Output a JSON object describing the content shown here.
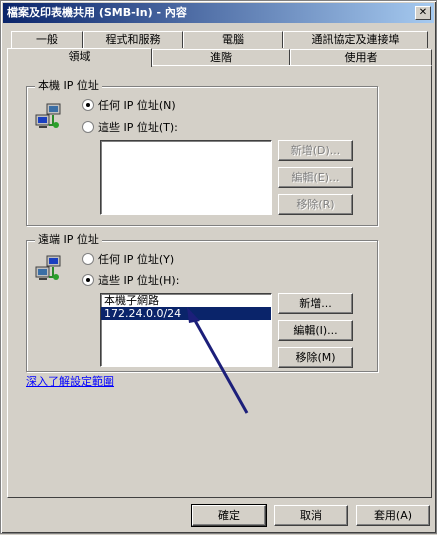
{
  "window": {
    "title": "檔案及印表機共用 (SMB-In) - 內容",
    "close": "✕"
  },
  "tabs": {
    "row1": [
      "一般",
      "程式和服務",
      "電腦",
      "通訊協定及連接埠"
    ],
    "row2": [
      "領域",
      "進階",
      "使用者"
    ]
  },
  "local": {
    "title": "本機 IP 位址",
    "any_ip": "任何 IP 位址(N)",
    "these_ip": "這些 IP 位址(T):",
    "selected": "any",
    "buttons": {
      "add": "新增(D)...",
      "edit": "編輯(E)...",
      "remove": "移除(R)"
    }
  },
  "remote": {
    "title": "遠端 IP 位址",
    "any_ip": "任何 IP 位址(Y)",
    "these_ip": "這些 IP 位址(H):",
    "selected": "these",
    "list": [
      "本機子網路",
      "172.24.0.0/24"
    ],
    "buttons": {
      "add": "新增...",
      "edit": "編輯(I)...",
      "remove": "移除(M)"
    }
  },
  "link_text": "深入了解設定範圍",
  "footer": {
    "ok": "確定",
    "cancel": "取消",
    "apply": "套用(A)"
  },
  "colors": {
    "selection": "#0a246a",
    "arrow": "#1c1f7a"
  },
  "icons": {
    "local_icon": "network-computers-icon",
    "remote_icon": "network-computers-icon"
  }
}
